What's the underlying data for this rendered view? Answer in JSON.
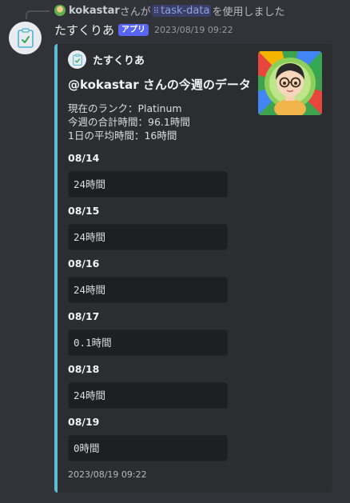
{
  "reply": {
    "user": "kokastar",
    "text_before": "さんが",
    "command": "task-data",
    "text_after": "を使用しました"
  },
  "message": {
    "author": "たすくりあ",
    "badge": "アプリ",
    "timestamp": "2023/08/19 09:22"
  },
  "embed": {
    "accent_color": "#5dbbd6",
    "author_name": "たすくりあ",
    "title": "@kokastar さんの今週のデータ",
    "description": [
      "現在のランク：Platinum",
      "今週の合計時間：96.1時間",
      "1日の平均時間：16時間"
    ],
    "fields": [
      {
        "name": "08/14",
        "value": "24時間"
      },
      {
        "name": "08/15",
        "value": "24時間"
      },
      {
        "name": "08/16",
        "value": "24時間"
      },
      {
        "name": "08/17",
        "value": "0.1時間"
      },
      {
        "name": "08/18",
        "value": "24時間"
      },
      {
        "name": "08/19",
        "value": "0時間"
      }
    ],
    "footer": "2023/08/19 09:22"
  },
  "icons": {
    "bot_avatar": "clipboard-check-icon",
    "reply_avatar": "user-avatar-icon",
    "command": "slash-command-icon",
    "thumbnail": "profile-illustration"
  }
}
